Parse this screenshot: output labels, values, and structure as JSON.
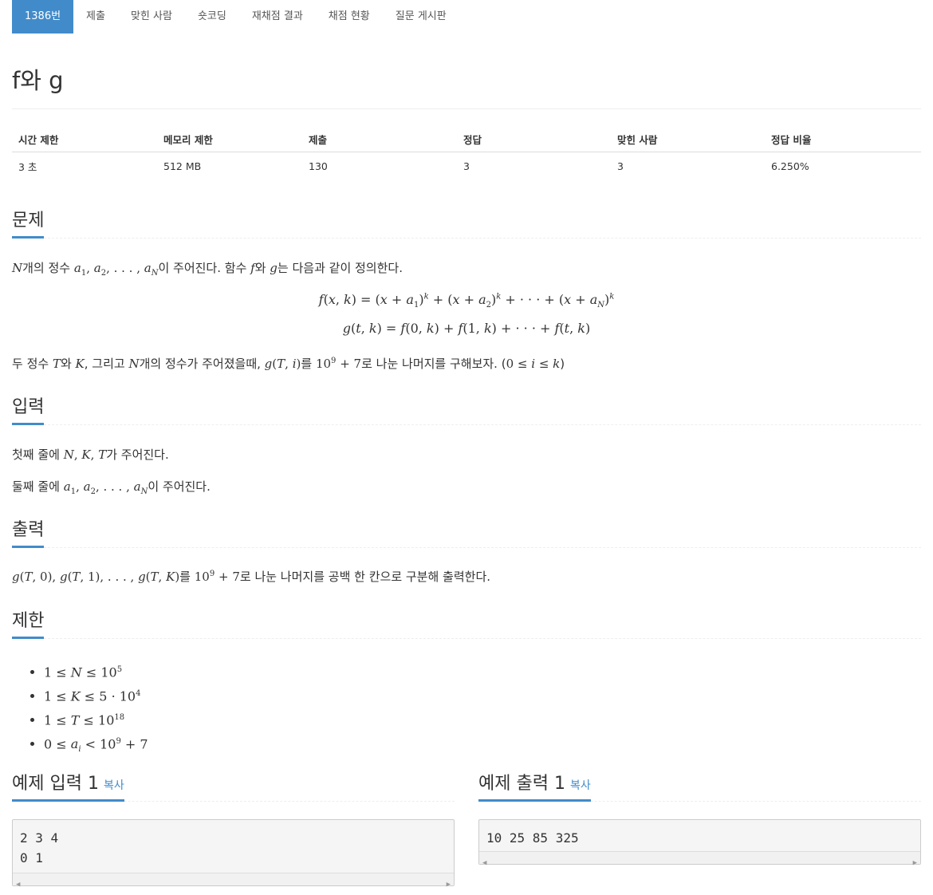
{
  "tabs": [
    {
      "label": "1386번",
      "active": true
    },
    {
      "label": "제출"
    },
    {
      "label": "맞힌 사람"
    },
    {
      "label": "숏코딩"
    },
    {
      "label": "재채점 결과"
    },
    {
      "label": "채점 현황"
    },
    {
      "label": "질문 게시판"
    }
  ],
  "title": "f와 g",
  "info": {
    "headers": [
      "시간 제한",
      "메모리 제한",
      "제출",
      "정답",
      "맞힌 사람",
      "정답 비율"
    ],
    "values": [
      "3 초",
      "512 MB",
      "130",
      "3",
      "3",
      "6.250%"
    ]
  },
  "sections": {
    "problem": "문제",
    "input": "입력",
    "output": "출력",
    "limit": "제한"
  },
  "problem": {
    "line1_a": "개의 정수 ",
    "line1_b": "이 주어진다. 함수 ",
    "line1_c": "와 ",
    "line1_d": "는 다음과 같이 정의한다.",
    "line2_a": "두 정수 ",
    "line2_b": "와 ",
    "line2_c": ", 그리고 ",
    "line2_d": "개의 정수가 주어졌을때, ",
    "line2_e": "를 ",
    "line2_f": "로 나눈 나머지를 구해보자. (",
    "line2_g": ")"
  },
  "input": {
    "line1_a": "첫째 줄에 ",
    "line1_b": "가 주어진다.",
    "line2_a": "둘째 줄에 ",
    "line2_b": "이 주어진다."
  },
  "output": {
    "text_a": "를 ",
    "text_b": "로 나눈 나머지를 공백 한 칸으로 구분해 출력한다."
  },
  "samples": {
    "input_title": "예제 입력 1",
    "output_title": "예제 출력 1",
    "copy_label": "복사",
    "input_text": "2 3 4\n0 1",
    "output_text": "10 25 85 325"
  }
}
